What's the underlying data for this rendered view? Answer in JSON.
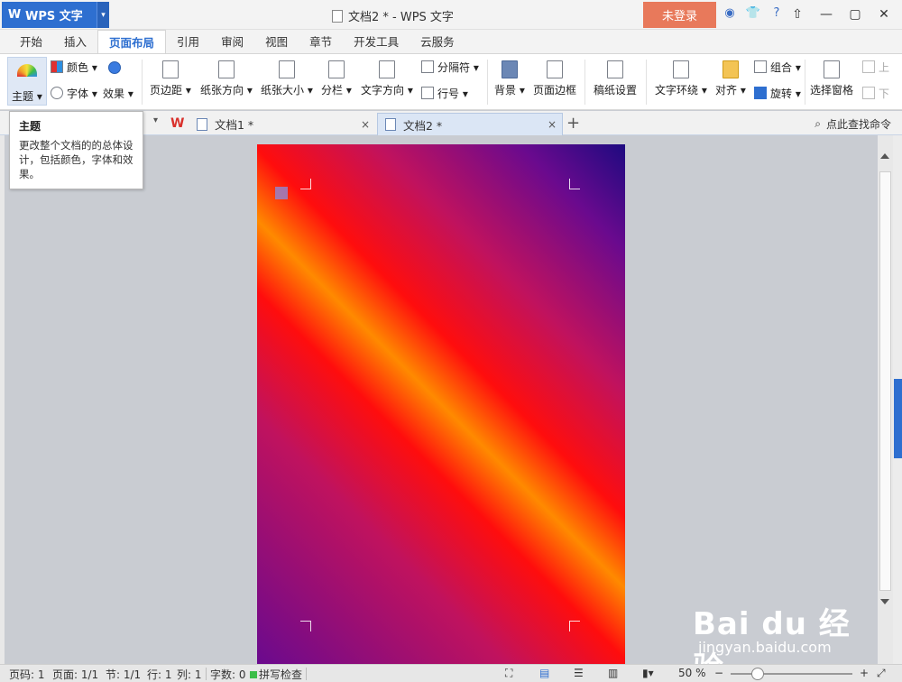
{
  "app": {
    "logo": "W",
    "name": "WPS 文字",
    "caret": "▾"
  },
  "window": {
    "title": "文档2 * - WPS 文字",
    "login": "未登录",
    "controls": {
      "restore_to_top": "⇧",
      "minimize": "—",
      "maximize": "▢",
      "close": "✕"
    }
  },
  "ribbon_tabs": [
    "开始",
    "插入",
    "页面布局",
    "引用",
    "审阅",
    "视图",
    "章节",
    "开发工具",
    "云服务"
  ],
  "active_tab_index": 2,
  "ribbon": {
    "theme": "主题 ▾",
    "color": "颜色 ▾",
    "font": "字体 ▾",
    "effect": "效果 ▾",
    "margins": "页边距 ▾",
    "orientation": "纸张方向 ▾",
    "size": "纸张大小 ▾",
    "columns": "分栏 ▾",
    "text_direction": "文字方向 ▾",
    "separator": "分隔符 ▾",
    "line_number": "行号 ▾",
    "background": "背景 ▾",
    "page_border": "页面边框",
    "manuscript": "稿纸设置",
    "wrap": "文字环绕 ▾",
    "align": "对齐 ▾",
    "group": "组合 ▾",
    "rotate": "旋转 ▾",
    "select_pane": "选择窗格",
    "up": "上",
    "down": "下"
  },
  "tooltip": {
    "title": "主题",
    "body": "更改整个文档的的总体设计，包括颜色，字体和效果。"
  },
  "doc_tabs": [
    {
      "label": "文档1 *",
      "close": "×",
      "active": false
    },
    {
      "label": "文档2 *",
      "close": "×",
      "active": true
    }
  ],
  "new_tab": "+",
  "find_command": "点此查找命令",
  "statusbar": {
    "page_code": "页码: 1",
    "page": "页面: 1/1",
    "section": "节: 1/1",
    "row": "行: 1",
    "col": "列: 1",
    "words": "字数: 0",
    "spell": "拼写检查",
    "zoom": "50 %",
    "zoom_minus": "−",
    "zoom_plus": "+"
  },
  "watermark": {
    "brand": "Bai du 经验",
    "url": "jingyan.baidu.com"
  },
  "colors": {
    "accent": "#2e6fd0",
    "login": "#e8795b",
    "tab_active": "#2e6fd0"
  }
}
